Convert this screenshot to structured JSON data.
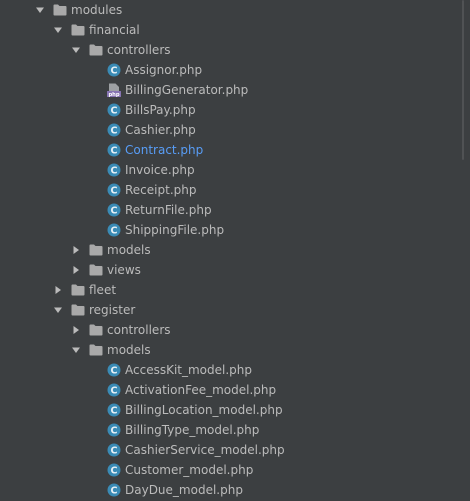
{
  "tree": [
    {
      "label": "modules",
      "depth": 0,
      "type": "folder",
      "expanded": true
    },
    {
      "label": "financial",
      "depth": 1,
      "type": "folder",
      "expanded": true
    },
    {
      "label": "controllers",
      "depth": 2,
      "type": "folder",
      "expanded": true
    },
    {
      "label": "Assignor.php",
      "depth": 3,
      "type": "class"
    },
    {
      "label": "BillingGenerator.php",
      "depth": 3,
      "type": "php"
    },
    {
      "label": "BillsPay.php",
      "depth": 3,
      "type": "class"
    },
    {
      "label": "Cashier.php",
      "depth": 3,
      "type": "class"
    },
    {
      "label": "Contract.php",
      "depth": 3,
      "type": "class",
      "active": true
    },
    {
      "label": "Invoice.php",
      "depth": 3,
      "type": "class"
    },
    {
      "label": "Receipt.php",
      "depth": 3,
      "type": "class"
    },
    {
      "label": "ReturnFile.php",
      "depth": 3,
      "type": "class"
    },
    {
      "label": "ShippingFile.php",
      "depth": 3,
      "type": "class"
    },
    {
      "label": "models",
      "depth": 2,
      "type": "folder",
      "expanded": false
    },
    {
      "label": "views",
      "depth": 2,
      "type": "folder",
      "expanded": false
    },
    {
      "label": "fleet",
      "depth": 1,
      "type": "folder",
      "expanded": false
    },
    {
      "label": "register",
      "depth": 1,
      "type": "folder",
      "expanded": true
    },
    {
      "label": "controllers",
      "depth": 2,
      "type": "folder",
      "expanded": false
    },
    {
      "label": "models",
      "depth": 2,
      "type": "folder",
      "expanded": true
    },
    {
      "label": "AccessKit_model.php",
      "depth": 3,
      "type": "class"
    },
    {
      "label": "ActivationFee_model.php",
      "depth": 3,
      "type": "class"
    },
    {
      "label": "BillingLocation_model.php",
      "depth": 3,
      "type": "class"
    },
    {
      "label": "BillingType_model.php",
      "depth": 3,
      "type": "class"
    },
    {
      "label": "CashierService_model.php",
      "depth": 3,
      "type": "class"
    },
    {
      "label": "Customer_model.php",
      "depth": 3,
      "type": "class"
    },
    {
      "label": "DayDue_model.php",
      "depth": 3,
      "type": "class"
    }
  ],
  "colors": {
    "background": "#3c3f41",
    "text": "#bbbbbb",
    "active_text": "#589df6",
    "folder": "#a9a9a9",
    "class_icon": "#3a8bb5",
    "php_icon": "#8774b2"
  },
  "icons": {
    "folder": "folder-icon",
    "class": "class-file-icon",
    "php": "php-file-icon",
    "expanded": "chevron-down-icon",
    "collapsed": "chevron-right-icon"
  },
  "php_badge": "php"
}
